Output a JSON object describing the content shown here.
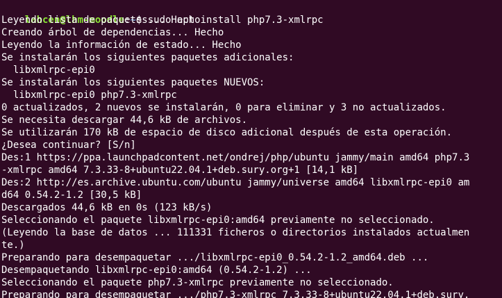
{
  "terminal": {
    "prompt": {
      "user_host": "lahcen@lhm-moodle",
      "colon": ":",
      "path": "~",
      "symbol": "$ ",
      "command": "sudo apt install php7.3-xmlrpc"
    },
    "lines": [
      "Leyendo lista de paquetes... Hecho",
      "Creando árbol de dependencias... Hecho",
      "Leyendo la información de estado... Hecho",
      "Se instalarán los siguientes paquetes adicionales:",
      "  libxmlrpc-epi0",
      "Se instalarán los siguientes paquetes NUEVOS:",
      "  libxmlrpc-epi0 php7.3-xmlrpc",
      "0 actualizados, 2 nuevos se instalarán, 0 para eliminar y 3 no actualizados.",
      "Se necesita descargar 44,6 kB de archivos.",
      "Se utilizarán 170 kB de espacio de disco adicional después de esta operación.",
      "¿Desea continuar? [S/n]",
      "Des:1 https://ppa.launchpadcontent.net/ondrej/php/ubuntu jammy/main amd64 php7.3",
      "-xmlrpc amd64 7.3.33-8+ubuntu22.04.1+deb.sury.org+1 [14,1 kB]",
      "Des:2 http://es.archive.ubuntu.com/ubuntu jammy/universe amd64 libxmlrpc-epi0 am",
      "d64 0.54.2-1.2 [30,5 kB]",
      "Descargados 44,6 kB en 0s (123 kB/s)",
      "Seleccionando el paquete libxmlrpc-epi0:amd64 previamente no seleccionado.",
      "(Leyendo la base de datos ... 111331 ficheros o directorios instalados actualmen",
      "te.)",
      "Preparando para desempaquetar .../libxmlrpc-epi0_0.54.2-1.2_amd64.deb ...",
      "Desempaquetando libxmlrpc-epi0:amd64 (0.54.2-1.2) ...",
      "Seleccionando el paquete php7.3-xmlrpc previamente no seleccionado.",
      "Preparando para desempaquetar .../php7.3-xmlrpc_7.3.33-8+ubuntu22.04.1+deb.sury."
    ]
  }
}
